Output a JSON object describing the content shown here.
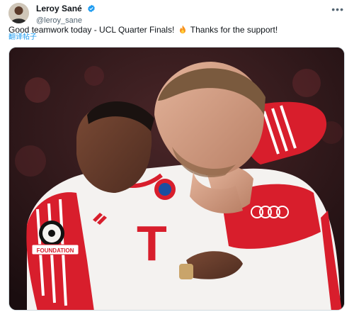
{
  "tweet": {
    "author": {
      "display_name": "Leroy Sané",
      "handle": "@leroy_sane",
      "verified": true,
      "avatar_icon": "user-avatar",
      "verified_color": "#1d9bf0"
    },
    "text_before_emoji": "Good teamwork today - UCL Quarter Finals!",
    "emoji_icon": "fire-icon",
    "text_after_emoji": "Thanks for the support!",
    "translate_label": "翻译帖子",
    "more_icon": "more-options-icon",
    "media": {
      "kit_text_sponsor": "T",
      "badge_text": "FOUNDATION",
      "colors": {
        "kit_red": "#d81e2c",
        "kit_white": "#f4f2f0",
        "background": "#2a1416"
      }
    }
  }
}
